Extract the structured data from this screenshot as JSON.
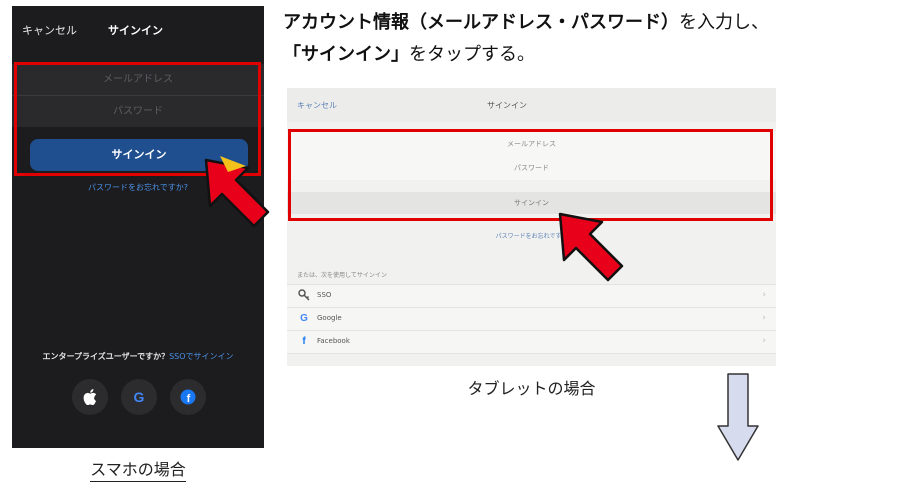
{
  "instruction": {
    "line1_bold": "アカウント情報（メールアドレス・パスワード）",
    "line1_rest": "を入力し、",
    "line2_bold": "「サインイン」",
    "line2_rest": "をタップする。"
  },
  "phone": {
    "cancel": "キャンセル",
    "title": "サインイン",
    "email_placeholder": "メールアドレス",
    "password_placeholder": "パスワード",
    "signin_button": "サインイン",
    "forgot": "パスワードをお忘れですか?",
    "enterprise_prefix": "エンタープライズユーザーですか？",
    "enterprise_link": "SSOでサインイン",
    "caption": "スマホの場合"
  },
  "tablet": {
    "cancel": "キャンセル",
    "title": "サインイン",
    "email_placeholder": "メールアドレス",
    "password_placeholder": "パスワード",
    "signin_button": "サインイン",
    "forgot": "パスワードをお忘れですか",
    "or_label": "または、次を使用してサインイン",
    "options": [
      "SSO",
      "Google",
      "Facebook"
    ],
    "caption": "タブレットの場合"
  },
  "colors": {
    "highlight_red": "#e00000",
    "link_blue": "#4a8fe7",
    "phone_button": "#1f4f8f",
    "down_arrow_fill": "#d6dbee"
  },
  "icons": [
    "apple-icon",
    "google-icon",
    "facebook-icon",
    "key-icon",
    "chevron-right-icon",
    "red-arrow",
    "down-arrow"
  ]
}
